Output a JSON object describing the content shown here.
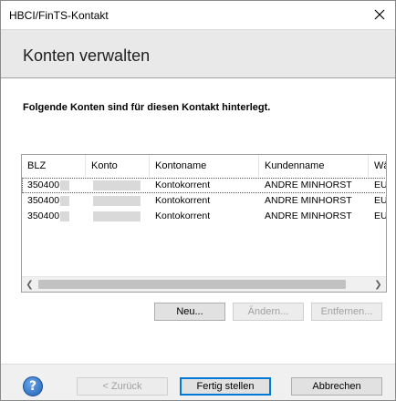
{
  "window": {
    "title": "HBCI/FinTS-Kontakt"
  },
  "header": {
    "heading": "Konten verwalten"
  },
  "info_text": "Folgende Konten sind für diesen Kontakt hinterlegt.",
  "table": {
    "columns": [
      "BLZ",
      "Konto",
      "Kontoname",
      "Kundenname",
      "Wä"
    ],
    "rows": [
      {
        "blz": "350400",
        "konto": "",
        "kontoname": "Kontokorrent",
        "kundenname": "ANDRE MINHORST",
        "waehrung": "EU"
      },
      {
        "blz": "350400",
        "konto": "",
        "kontoname": "Kontokorrent",
        "kundenname": "ANDRE MINHORST",
        "waehrung": "EU"
      },
      {
        "blz": "350400",
        "konto": "",
        "kontoname": "Kontokorrent",
        "kundenname": "ANDRE MINHORST",
        "waehrung": "EU"
      }
    ]
  },
  "list_buttons": {
    "new": "Neu...",
    "edit": "Ändern...",
    "remove": "Entfernen..."
  },
  "footer": {
    "help": "?",
    "back": "< Zurück",
    "finish": "Fertig stellen",
    "cancel": "Abbrechen"
  },
  "icons": {
    "close": "close-icon",
    "help": "help-icon",
    "scroll_left": "chevron-left-icon",
    "scroll_right": "chevron-right-icon"
  },
  "colors": {
    "header_bg": "#e9e9e9",
    "default_button_border": "#0078d7",
    "help_icon": "#1f5fb5"
  }
}
